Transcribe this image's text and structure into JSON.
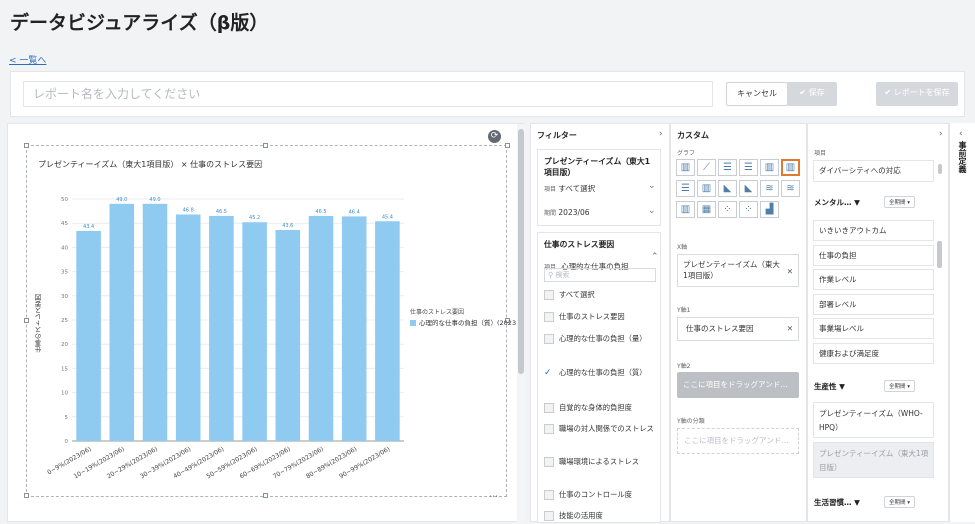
{
  "page": {
    "title": "データビジュアライズ（β版）",
    "back_link": "< 一覧へ"
  },
  "report": {
    "name_placeholder": "レポート名を入力してください",
    "cancel": "キャンセル",
    "save": "✔ 保存",
    "save_report": "✔ レポートを保存"
  },
  "chart_data": {
    "type": "bar",
    "title": "プレゼンティーイズム（東大1項目版） × 仕事のストレス要因",
    "xlabel": "",
    "ylabel": "仕事のストレス要因",
    "ylim": [
      0,
      50
    ],
    "yticks": [
      0,
      5,
      10,
      15,
      20,
      25,
      30,
      35,
      40,
      45,
      50
    ],
    "categories": [
      "0~9%(2023/06)",
      "10~19%(2023/06)",
      "20~29%(2023/06)",
      "30~39%(2023/06)",
      "40~49%(2023/06)",
      "50~59%(2023/06)",
      "60~69%(2023/06)",
      "70~79%(2023/06)",
      "80~89%(2023/06)",
      "90~99%(2023/06)"
    ],
    "series": [
      {
        "name": "心理的な仕事の負担（質）(2023",
        "values": [
          43.4,
          49.0,
          49.0,
          46.8,
          46.5,
          45.2,
          43.6,
          46.5,
          46.4,
          45.4
        ]
      }
    ],
    "value_labels": [
      "43.4",
      "49.0",
      "49.0",
      "46.8",
      "46.5",
      "45.2",
      "43.6",
      "46.5",
      "46.4",
      "45.4"
    ],
    "legend_title": "仕事のストレス要因",
    "legend_position": "right",
    "grid": true,
    "bar_color": "#8fcaf1"
  },
  "filter": {
    "header": "フィルター",
    "card1": {
      "title": "プレゼンティーイズム（東大1項目版）",
      "item_label": "項目",
      "item_value": "すべて選択",
      "period_label": "期間",
      "period_value": "2023/06"
    },
    "card2": {
      "title": "仕事のストレス要因",
      "item_label": "項目",
      "item_value": "心理的な仕事の負担…",
      "search_placeholder": "検索",
      "options": [
        "すべて選択",
        "仕事のストレス要因",
        "心理的な仕事の負担（量）",
        "心理的な仕事の負担（質）",
        "自覚的な身体的負担度",
        "職場の対人関係でのストレス",
        "職場環境によるストレス",
        "仕事のコントロール度",
        "技能の活用度"
      ]
    }
  },
  "custom": {
    "header": "カスタム",
    "graph_label": "グラフ",
    "x_label": "X軸",
    "x_value": "プレゼンティーイズム（東大1項目版）",
    "y1_label": "Y軸1",
    "y1_value": "仕事のストレス要因",
    "y2_label": "Y軸2",
    "y2_placeholder": "ここに項目をドラッグアンド…",
    "ysplit_label": "Y軸の分類",
    "ysplit_placeholder": "ここに項目をドラッグアンド…"
  },
  "items": {
    "header": "項目",
    "top_item": "ダイバーシティへの対応",
    "mental": {
      "label": "メンタル…",
      "period": "全期間",
      "items": [
        "いきいきアウトカム",
        "仕事の負担",
        "作業レベル",
        "部署レベル",
        "事業場レベル",
        "健康および満足度"
      ]
    },
    "productivity": {
      "label": "生産性",
      "period": "全期間",
      "items": [
        "プレゼンティーイズム（WHO-HPQ）",
        "プレゼンティーイズム（東大1項目版）"
      ]
    },
    "lifestyle": {
      "label": "生活習慣…",
      "period": "全期間"
    }
  },
  "side_tab": "事前定義"
}
